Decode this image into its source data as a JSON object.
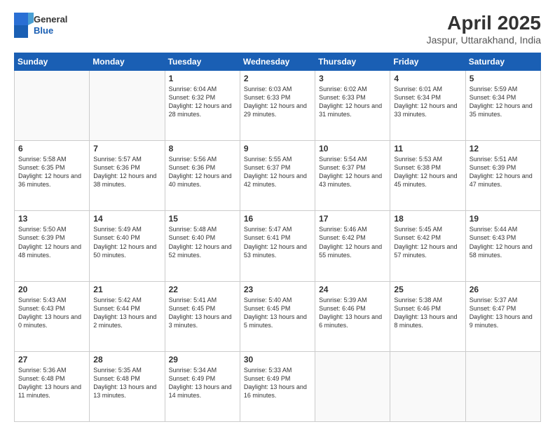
{
  "header": {
    "logo": {
      "line1": "General",
      "line2": "Blue"
    },
    "title": "April 2025",
    "subtitle": "Jaspur, Uttarakhand, India"
  },
  "weekdays": [
    "Sunday",
    "Monday",
    "Tuesday",
    "Wednesday",
    "Thursday",
    "Friday",
    "Saturday"
  ],
  "weeks": [
    [
      {
        "day": "",
        "sunrise": "",
        "sunset": "",
        "daylight": ""
      },
      {
        "day": "",
        "sunrise": "",
        "sunset": "",
        "daylight": ""
      },
      {
        "day": "1",
        "sunrise": "Sunrise: 6:04 AM",
        "sunset": "Sunset: 6:32 PM",
        "daylight": "Daylight: 12 hours and 28 minutes."
      },
      {
        "day": "2",
        "sunrise": "Sunrise: 6:03 AM",
        "sunset": "Sunset: 6:33 PM",
        "daylight": "Daylight: 12 hours and 29 minutes."
      },
      {
        "day": "3",
        "sunrise": "Sunrise: 6:02 AM",
        "sunset": "Sunset: 6:33 PM",
        "daylight": "Daylight: 12 hours and 31 minutes."
      },
      {
        "day": "4",
        "sunrise": "Sunrise: 6:01 AM",
        "sunset": "Sunset: 6:34 PM",
        "daylight": "Daylight: 12 hours and 33 minutes."
      },
      {
        "day": "5",
        "sunrise": "Sunrise: 5:59 AM",
        "sunset": "Sunset: 6:34 PM",
        "daylight": "Daylight: 12 hours and 35 minutes."
      }
    ],
    [
      {
        "day": "6",
        "sunrise": "Sunrise: 5:58 AM",
        "sunset": "Sunset: 6:35 PM",
        "daylight": "Daylight: 12 hours and 36 minutes."
      },
      {
        "day": "7",
        "sunrise": "Sunrise: 5:57 AM",
        "sunset": "Sunset: 6:36 PM",
        "daylight": "Daylight: 12 hours and 38 minutes."
      },
      {
        "day": "8",
        "sunrise": "Sunrise: 5:56 AM",
        "sunset": "Sunset: 6:36 PM",
        "daylight": "Daylight: 12 hours and 40 minutes."
      },
      {
        "day": "9",
        "sunrise": "Sunrise: 5:55 AM",
        "sunset": "Sunset: 6:37 PM",
        "daylight": "Daylight: 12 hours and 42 minutes."
      },
      {
        "day": "10",
        "sunrise": "Sunrise: 5:54 AM",
        "sunset": "Sunset: 6:37 PM",
        "daylight": "Daylight: 12 hours and 43 minutes."
      },
      {
        "day": "11",
        "sunrise": "Sunrise: 5:53 AM",
        "sunset": "Sunset: 6:38 PM",
        "daylight": "Daylight: 12 hours and 45 minutes."
      },
      {
        "day": "12",
        "sunrise": "Sunrise: 5:51 AM",
        "sunset": "Sunset: 6:39 PM",
        "daylight": "Daylight: 12 hours and 47 minutes."
      }
    ],
    [
      {
        "day": "13",
        "sunrise": "Sunrise: 5:50 AM",
        "sunset": "Sunset: 6:39 PM",
        "daylight": "Daylight: 12 hours and 48 minutes."
      },
      {
        "day": "14",
        "sunrise": "Sunrise: 5:49 AM",
        "sunset": "Sunset: 6:40 PM",
        "daylight": "Daylight: 12 hours and 50 minutes."
      },
      {
        "day": "15",
        "sunrise": "Sunrise: 5:48 AM",
        "sunset": "Sunset: 6:40 PM",
        "daylight": "Daylight: 12 hours and 52 minutes."
      },
      {
        "day": "16",
        "sunrise": "Sunrise: 5:47 AM",
        "sunset": "Sunset: 6:41 PM",
        "daylight": "Daylight: 12 hours and 53 minutes."
      },
      {
        "day": "17",
        "sunrise": "Sunrise: 5:46 AM",
        "sunset": "Sunset: 6:42 PM",
        "daylight": "Daylight: 12 hours and 55 minutes."
      },
      {
        "day": "18",
        "sunrise": "Sunrise: 5:45 AM",
        "sunset": "Sunset: 6:42 PM",
        "daylight": "Daylight: 12 hours and 57 minutes."
      },
      {
        "day": "19",
        "sunrise": "Sunrise: 5:44 AM",
        "sunset": "Sunset: 6:43 PM",
        "daylight": "Daylight: 12 hours and 58 minutes."
      }
    ],
    [
      {
        "day": "20",
        "sunrise": "Sunrise: 5:43 AM",
        "sunset": "Sunset: 6:43 PM",
        "daylight": "Daylight: 13 hours and 0 minutes."
      },
      {
        "day": "21",
        "sunrise": "Sunrise: 5:42 AM",
        "sunset": "Sunset: 6:44 PM",
        "daylight": "Daylight: 13 hours and 2 minutes."
      },
      {
        "day": "22",
        "sunrise": "Sunrise: 5:41 AM",
        "sunset": "Sunset: 6:45 PM",
        "daylight": "Daylight: 13 hours and 3 minutes."
      },
      {
        "day": "23",
        "sunrise": "Sunrise: 5:40 AM",
        "sunset": "Sunset: 6:45 PM",
        "daylight": "Daylight: 13 hours and 5 minutes."
      },
      {
        "day": "24",
        "sunrise": "Sunrise: 5:39 AM",
        "sunset": "Sunset: 6:46 PM",
        "daylight": "Daylight: 13 hours and 6 minutes."
      },
      {
        "day": "25",
        "sunrise": "Sunrise: 5:38 AM",
        "sunset": "Sunset: 6:46 PM",
        "daylight": "Daylight: 13 hours and 8 minutes."
      },
      {
        "day": "26",
        "sunrise": "Sunrise: 5:37 AM",
        "sunset": "Sunset: 6:47 PM",
        "daylight": "Daylight: 13 hours and 9 minutes."
      }
    ],
    [
      {
        "day": "27",
        "sunrise": "Sunrise: 5:36 AM",
        "sunset": "Sunset: 6:48 PM",
        "daylight": "Daylight: 13 hours and 11 minutes."
      },
      {
        "day": "28",
        "sunrise": "Sunrise: 5:35 AM",
        "sunset": "Sunset: 6:48 PM",
        "daylight": "Daylight: 13 hours and 13 minutes."
      },
      {
        "day": "29",
        "sunrise": "Sunrise: 5:34 AM",
        "sunset": "Sunset: 6:49 PM",
        "daylight": "Daylight: 13 hours and 14 minutes."
      },
      {
        "day": "30",
        "sunrise": "Sunrise: 5:33 AM",
        "sunset": "Sunset: 6:49 PM",
        "daylight": "Daylight: 13 hours and 16 minutes."
      },
      {
        "day": "",
        "sunrise": "",
        "sunset": "",
        "daylight": ""
      },
      {
        "day": "",
        "sunrise": "",
        "sunset": "",
        "daylight": ""
      },
      {
        "day": "",
        "sunrise": "",
        "sunset": "",
        "daylight": ""
      }
    ]
  ]
}
